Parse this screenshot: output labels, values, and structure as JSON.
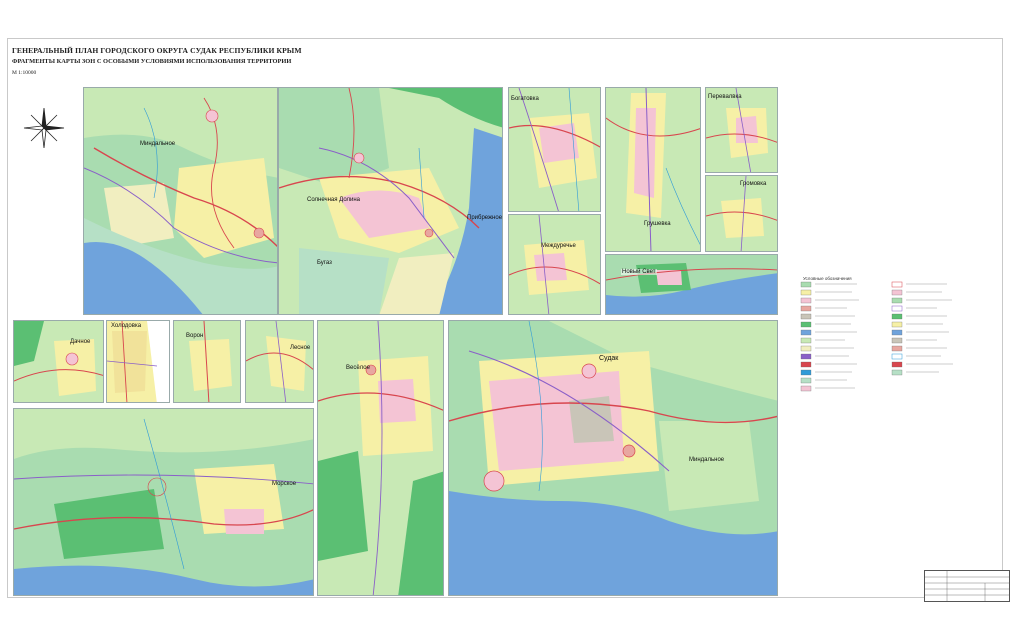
{
  "header": {
    "title": "ГЕНЕРАЛЬНЫЙ ПЛАН ГОРОДСКОГО ОКРУГА СУДАК РЕСПУБЛИКИ КРЫМ",
    "subtitle": "ФРАГМЕНТЫ КАРТЫ ЗОН С ОСОБЫМИ УСЛОВИЯМИ ИСПОЛЬЗОВАНИЯ ТЕРРИТОРИИ",
    "scale": "М 1:10000"
  },
  "places": {
    "mindalnoe_1": "Миндальное",
    "solnechnaya_dolina": "Солнечная Долина",
    "prybrezhnoe": "Прибрежное",
    "bugaz": "Бугаз",
    "bogatovka": "Богатовка",
    "pereval": "Перевалвка",
    "gromovka": "Громовка",
    "grushevka": "Грушевка",
    "mezhdurechye": "Междуречье",
    "novy_svet": "Новый Свет",
    "dachnoe": "Дачное",
    "gorodovka": "Холодовка",
    "voron": "Ворон",
    "lesnoe": "Лесное",
    "morskoe": "Морское",
    "veseloe": "Весёлое",
    "sudak": "Судак",
    "mindalnoe_2": "Миндальное"
  },
  "legend": {
    "title": "Условные обозначения"
  },
  "colors": {
    "sea": "#6fa3dc",
    "forest": "#a9dcb0",
    "green_dark": "#5bbf73",
    "farmland": "#f6f0a6",
    "residential": "#f4c4d4",
    "road_red": "#d8464e",
    "road_purple": "#8a5fc8",
    "water_line": "#2f9bd8",
    "gray": "#c9c5b8"
  }
}
